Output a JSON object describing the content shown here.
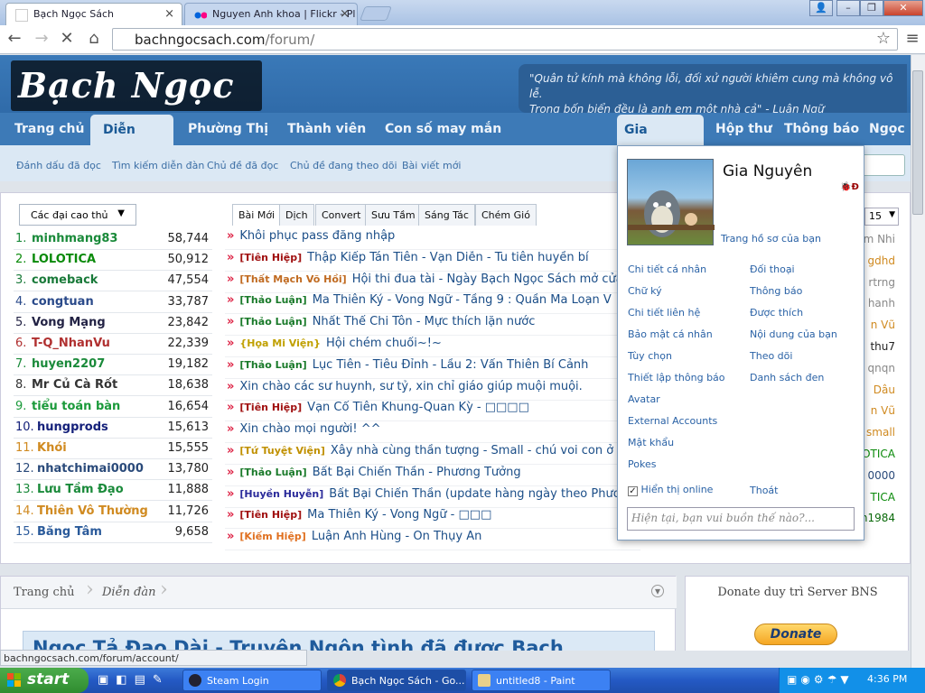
{
  "browser": {
    "tabs": [
      {
        "label": "Bạch Ngọc Sách",
        "close": "×"
      },
      {
        "label": "Nguyen Anh khoa | Flickr - Pl",
        "close": "×"
      }
    ],
    "url_host": "bachngocsach.com",
    "url_path": "/forum/",
    "status_url": "bachngocsach.com/forum/account/"
  },
  "site": {
    "logo_text": "Bạch Ngọc Sách",
    "quote_line1": "\"Quân tử kính mà không lỗi, đối xử người khiêm cung mà không vô lễ.",
    "quote_line2": "Trong bốn biển đều là anh em một nhà cả\" - Luận Ngữ",
    "nav": [
      "Trang chủ",
      "Diễn đàn",
      "Phường Thị",
      "Thành viên",
      "Con số may mắn",
      "Gia Nguyên",
      "Hộp thư",
      "Thông báo",
      "Ngọc"
    ],
    "subnav": [
      "Đánh dấu đã đọc",
      "Tìm kiếm diễn đàn",
      "Chủ đề đã đọc",
      "Chủ đề đang theo dõi",
      "Bài viết mới"
    ]
  },
  "leaderboard": {
    "dropdown": "Các đại cao thủ",
    "rows": [
      {
        "rank": "1.",
        "user": "minhmang83",
        "score": "58,744",
        "color": "#1a8a3a"
      },
      {
        "rank": "2.",
        "user": "LOLOTICA",
        "score": "50,912",
        "color": "#0a8a0a"
      },
      {
        "rank": "3.",
        "user": "comeback",
        "score": "47,554",
        "color": "#1a7a3a"
      },
      {
        "rank": "4.",
        "user": "congtuan",
        "score": "33,787",
        "color": "#2a4a8a"
      },
      {
        "rank": "5.",
        "user": "Vong Mạng",
        "score": "23,842",
        "color": "#222244"
      },
      {
        "rank": "6.",
        "user": "T-Q_NhanVu",
        "score": "22,339",
        "color": "#b03030"
      },
      {
        "rank": "7.",
        "user": "huyen2207",
        "score": "19,182",
        "color": "#1a8a3a"
      },
      {
        "rank": "8.",
        "user": "Mr Củ Cà Rốt",
        "score": "18,638",
        "color": "#333"
      },
      {
        "rank": "9.",
        "user": "tiểu toán bàn",
        "score": "16,654",
        "color": "#1a9a3a"
      },
      {
        "rank": "10.",
        "user": "hungprods",
        "score": "15,613",
        "color": "#14207a"
      },
      {
        "rank": "11.",
        "user": "Khói",
        "score": "15,555",
        "color": "#d08a20"
      },
      {
        "rank": "12.",
        "user": "nhatchimai0000",
        "score": "13,780",
        "color": "#2a4a7a"
      },
      {
        "rank": "13.",
        "user": "Lưu Tầm Đạo",
        "score": "11,888",
        "color": "#1a8a3a"
      },
      {
        "rank": "14.",
        "user": "Thiên Vô Thường",
        "score": "11,726",
        "color": "#d08a20"
      },
      {
        "rank": "15.",
        "user": "Băng Tâm",
        "score": "9,658",
        "color": "#2a5a9a"
      }
    ]
  },
  "thread_tabs": [
    "Bài Mới",
    "Dịch",
    "Convert",
    "Sưu Tầm",
    "Sáng Tác",
    "Chém Gió"
  ],
  "threads": [
    {
      "tag": "",
      "tag_color": "",
      "title": "Khôi phục pass đăng nhập"
    },
    {
      "tag": "[Tiên Hiệp]",
      "tag_color": "#a01010",
      "title": "Thập Kiếp Tán Tiên - Vạn Diễn - Tu tiên huyền bí"
    },
    {
      "tag": "[Thất Mạch Võ Hồi]",
      "tag_color": "#c06a20",
      "title": "Hội thi đua tài - Ngày Bạch Ngọc Sách mở cửa"
    },
    {
      "tag": "[Thảo Luận]",
      "tag_color": "#1a7a2a",
      "title": "Ma Thiên Ký - Vong Ngữ - Tầng 9 : Quần Ma Loạn V"
    },
    {
      "tag": "[Thảo Luận]",
      "tag_color": "#1a7a2a",
      "title": "Nhất Thế Chi Tôn - Mực thích lặn nước"
    },
    {
      "tag": "{Họa Mi Viện}",
      "tag_color": "#c0a000",
      "title": "Hội chém chuối~!~"
    },
    {
      "tag": "[Thảo Luận]",
      "tag_color": "#1a7a2a",
      "title": "Lục Tiên - Tiêu Đỉnh - Lầu 2: Vấn Thiên Bí Cảnh"
    },
    {
      "tag": "",
      "tag_color": "",
      "title": "Xin chào các sư huynh, sư tỷ, xin chỉ giáo giúp muội muội."
    },
    {
      "tag": "[Tiên Hiệp]",
      "tag_color": "#a01010",
      "title": "Vạn Cổ Tiên Khung-Quan Kỳ - □□□□"
    },
    {
      "tag": "",
      "tag_color": "",
      "title": "Xin chào mọi người! ^^"
    },
    {
      "tag": "[Tứ Tuyệt Viện]",
      "tag_color": "#c09000",
      "title": "Xây nhà cùng thần tượng - Small - chú voi con ở b"
    },
    {
      "tag": "[Thảo Luận]",
      "tag_color": "#1a7a2a",
      "title": "Bất Bại Chiến Thần - Phương Tưởng"
    },
    {
      "tag": "[Huyền Huyễn]",
      "tag_color": "#2a2a9a",
      "title": "Bất Bại Chiến Thần (update hàng ngày theo Phươ"
    },
    {
      "tag": "[Tiên Hiệp]",
      "tag_color": "#a01010",
      "title": "Ma Thiên Ký - Vong Ngữ - □□□"
    },
    {
      "tag": "[Kiếm Hiệp]",
      "tag_color": "#e07020",
      "title": "Luận Anh Hùng - Ôn Thụy An"
    }
  ],
  "right_column": {
    "page_select": "15",
    "names": [
      {
        "text": "Hàn Lâm Nhi",
        "color": "#888"
      },
      {
        "text": "gdhd",
        "color": "#d08a20"
      },
      {
        "text": "rtrng",
        "color": "#888"
      },
      {
        "text": "hanh",
        "color": "#888"
      },
      {
        "text": "n Vũ",
        "color": "#d08a20"
      },
      {
        "text": "thu7",
        "color": "#222"
      },
      {
        "text": "qnqn",
        "color": "#888"
      },
      {
        "text": "Dâu",
        "color": "#d08a20"
      },
      {
        "text": "n Vũ",
        "color": "#d08a20"
      },
      {
        "text": "small",
        "color": "#d08a20"
      },
      {
        "text": "LOTICA",
        "color": "#0a8a0a"
      },
      {
        "text": "0000",
        "color": "#2a4a7a"
      },
      {
        "text": "TICA",
        "color": "#0a8a0a"
      },
      {
        "text": "archnguyen1984",
        "color": "#0a6a0a"
      }
    ]
  },
  "user_popup": {
    "name": "Gia Nguyên",
    "profile_link": "Trang hồ sơ của bạn",
    "badge": "🐞Đ",
    "left_links": [
      "Chi tiết cá nhân",
      "Chữ ký",
      "Chi tiết liên hệ",
      "Bảo mật cá nhân",
      "Tùy chọn",
      "Thiết lập thông báo",
      "Avatar",
      "External Accounts",
      "Mật khẩu",
      "Pokes"
    ],
    "right_links": [
      "Đối thoại",
      "Thông báo",
      "Được thích",
      "Nội dung của bạn",
      "Theo dõi",
      "Danh sách đen"
    ],
    "show_online": "Hiển thị online",
    "logout": "Thoát",
    "status_placeholder": "Hiện tại, bạn vui buồn thế nào?..."
  },
  "lower": {
    "crumb_home": "Trang chủ",
    "crumb_forum": "Diễn đàn",
    "banner": "Ngọc Tả Đạo Dài - Truyện Ngôn tình đã được Bạch",
    "donate_title": "Donate duy trì Server BNS",
    "donate_button": "Donate"
  },
  "taskbar": {
    "start": "start",
    "tasks": [
      "Steam Login",
      "Bạch Ngọc Sách - Go...",
      "untitled8 - Paint"
    ],
    "clock": "4:36 PM"
  }
}
